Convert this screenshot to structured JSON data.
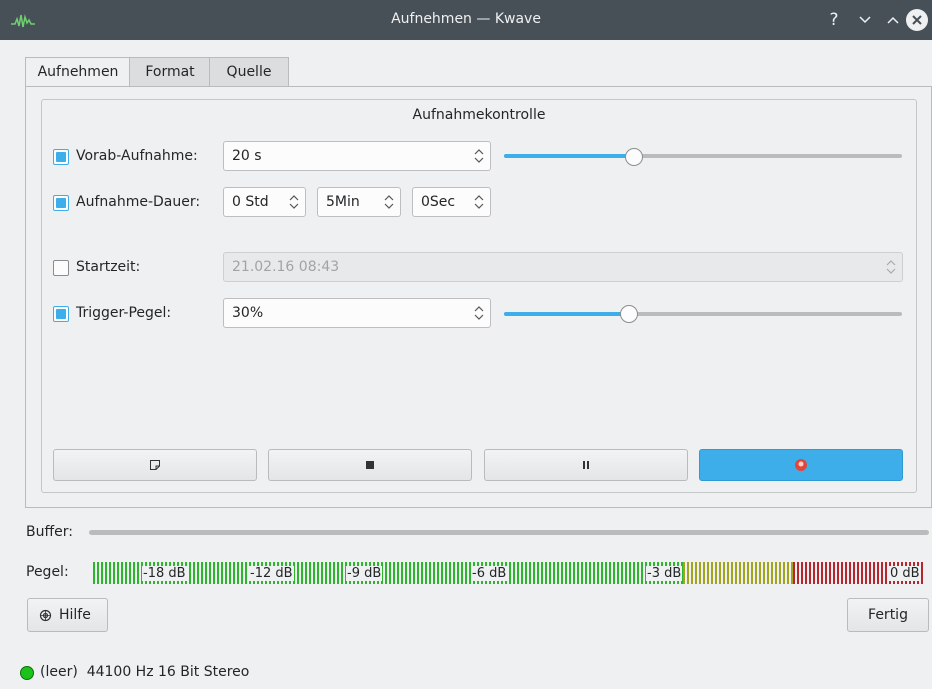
{
  "window": {
    "title": "Aufnehmen — Kwave",
    "help_glyph": "?",
    "colors": {
      "titlebar": "#475057",
      "accent": "#3daee9",
      "led": "#1ac21a"
    }
  },
  "tabs": [
    {
      "label": "Aufnehmen",
      "active": true
    },
    {
      "label": "Format",
      "active": false
    },
    {
      "label": "Quelle",
      "active": false
    }
  ],
  "record_control": {
    "title": "Aufnahmekontrolle",
    "prerecord": {
      "label": "Vorab-Aufnahme:",
      "checked": true,
      "value": "20 s",
      "slider_fraction": 0.3
    },
    "duration": {
      "label": "Aufnahme-Dauer:",
      "checked": true,
      "hours": "0 Std",
      "minutes": "5Min",
      "seconds": "0Sec"
    },
    "start_time": {
      "label": "Startzeit:",
      "checked": false,
      "value": "21.02.16 08:43"
    },
    "trigger": {
      "label": "Trigger-Pegel:",
      "checked": true,
      "value": "30%",
      "slider_fraction": 0.3
    }
  },
  "controls": [
    {
      "name": "new",
      "icon": "new-document-icon"
    },
    {
      "name": "stop",
      "icon": "stop-icon"
    },
    {
      "name": "pause",
      "icon": "pause-icon"
    },
    {
      "name": "record",
      "icon": "record-icon"
    }
  ],
  "buffer": {
    "label": "Buffer:"
  },
  "level": {
    "label": "Pegel:",
    "ticks": [
      "-18 dB",
      "-12 dB",
      "-9 dB",
      "-6 dB",
      "-3 dB",
      "0 dB"
    ]
  },
  "footer": {
    "help_label": "Hilfe",
    "done_label": "Fertig"
  },
  "status": {
    "text": "(leer)  44100 Hz 16 Bit Stereo"
  }
}
